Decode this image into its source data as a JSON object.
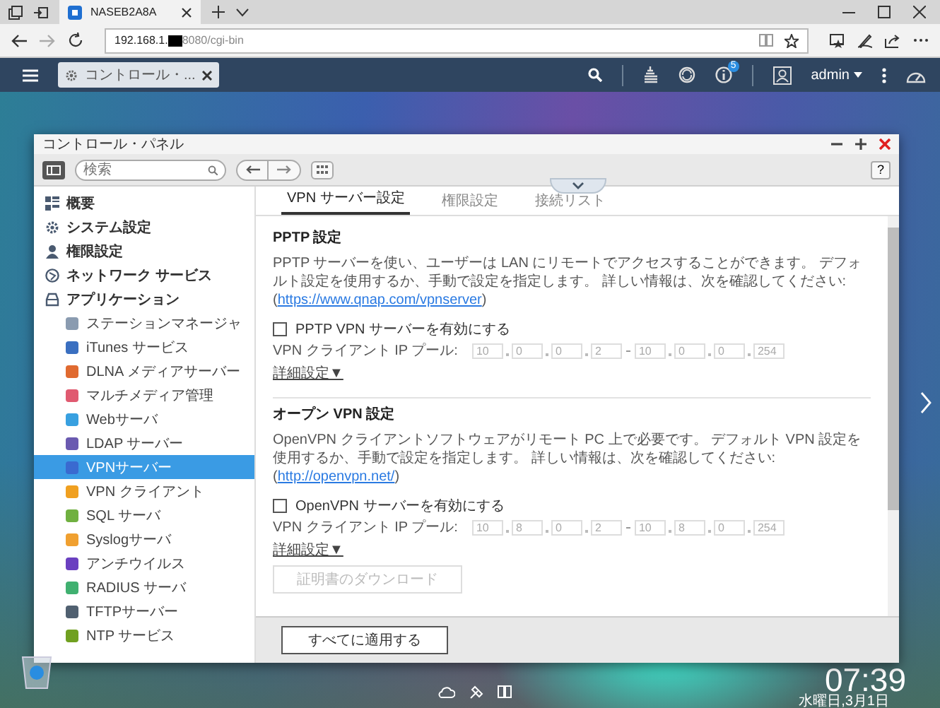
{
  "browser": {
    "tabs": [
      {
        "title": "NASEB2A8A",
        "selected": true
      }
    ],
    "address": {
      "host": "192.168.1.",
      "path": "8080/cgi-bin"
    }
  },
  "top_bar": {
    "app_tabs": [
      {
        "label": "コントロール・...",
        "selected": true
      }
    ],
    "notification_count": "5",
    "user": "admin"
  },
  "window": {
    "title": "コントロール・パネル",
    "search_placeholder": "検索",
    "help": "?"
  },
  "sidebar": {
    "items": [
      {
        "label": "概要",
        "selected": false
      },
      {
        "label": "システム設定",
        "selected": false
      },
      {
        "label": "権限設定",
        "selected": false
      },
      {
        "label": "ネットワーク サービス",
        "selected": false
      },
      {
        "label": "アプリケーション",
        "selected": false,
        "children": [
          {
            "label": "ステーションマネージャ",
            "selected": false
          },
          {
            "label": "iTunes サービス",
            "selected": false
          },
          {
            "label": "DLNA メディアサーバー",
            "selected": false
          },
          {
            "label": "マルチメディア管理",
            "selected": false
          },
          {
            "label": "Webサーバ",
            "selected": false
          },
          {
            "label": "LDAP サーバー",
            "selected": false
          },
          {
            "label": "VPNサーバー",
            "selected": true
          },
          {
            "label": "VPN クライアント",
            "selected": false
          },
          {
            "label": "SQL サーバ",
            "selected": false
          },
          {
            "label": "Syslogサーバ",
            "selected": false
          },
          {
            "label": "アンチウイルス",
            "selected": false
          },
          {
            "label": "RADIUS サーバ",
            "selected": false
          },
          {
            "label": "TFTPサーバー",
            "selected": false
          },
          {
            "label": "NTP サービス",
            "selected": false
          }
        ]
      }
    ]
  },
  "tabs": [
    {
      "label": "VPN サーバー設定",
      "selected": true
    },
    {
      "label": "権限設定",
      "selected": false
    },
    {
      "label": "接続リスト",
      "selected": false
    }
  ],
  "sections": [
    {
      "title": "PPTP 設定",
      "description": "PPTP サーバーを使い、ユーザーは LAN にリモートでアクセスすることができます。 デフォルト設定を使用するか、手動で設定を指定します。 詳しい情報は、次を確認してください: (",
      "link": "https://www.qnap.com/vpnserver",
      "description_end": ")",
      "enable": {
        "label": "PPTP VPN サーバーを有効にする",
        "checked": false
      },
      "pool": {
        "label": "VPN クライアント IP プール:",
        "start": [
          "10",
          "0",
          "0",
          "2"
        ],
        "end": [
          "10",
          "0",
          "0",
          "254"
        ]
      },
      "advanced": "詳細設定▼"
    },
    {
      "title": "オープン VPN 設定",
      "description": "OpenVPN クライアントソフトウェアがリモート PC 上で必要です。 デフォルト VPN 設定を使用するか、手動で設定を指定します。 詳しい情報は、次を確認してください: (",
      "link": "http://openvpn.net/",
      "description_end": ")",
      "enable": {
        "label": "OpenVPN サーバーを有効にする",
        "checked": false
      },
      "pool": {
        "label": "VPN クライアント IP プール:",
        "start": [
          "10",
          "8",
          "0",
          "2"
        ],
        "end": [
          "10",
          "8",
          "0",
          "254"
        ]
      },
      "advanced": "詳細設定▼",
      "download": {
        "label": "証明書のダウンロード",
        "disabled": true
      }
    }
  ],
  "apply_button": "すべてに適用する",
  "desktop": {
    "clock": "07:39",
    "date": "水曜日,3月1日"
  }
}
